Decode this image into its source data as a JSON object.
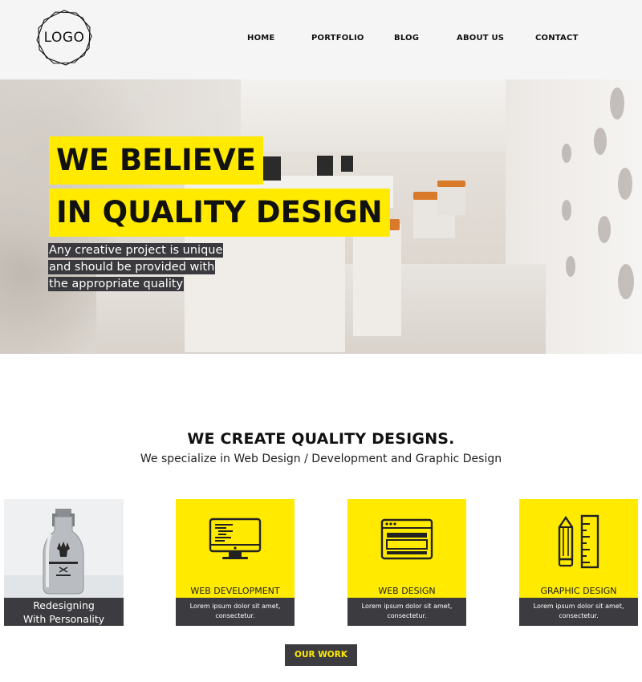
{
  "logo": {
    "text": "LOGO"
  },
  "nav": [
    {
      "label": "HOME"
    },
    {
      "label": "PORTFOLIO"
    },
    {
      "label": "BLOG"
    },
    {
      "label": "ABOUT US"
    },
    {
      "label": "CONTACT"
    }
  ],
  "hero": {
    "title_line1": "WE BELIEVE",
    "title_line2": "IN QUALITY DESIGN",
    "subtitle_lines": [
      "Any creative project is unique",
      "and should be provided with",
      "the appropriate quality"
    ]
  },
  "section": {
    "title": "WE CREATE QUALITY DESIGNS.",
    "subtitle": "We specialize in Web Design / Development and Graphic Design"
  },
  "photo_card": {
    "caption_line1": "Redesigning",
    "caption_line2": "With Personality"
  },
  "cards": [
    {
      "title": "WEB DEVELOPMENT",
      "text_line1": "Lorem ipsum dolor sit amet,",
      "text_line2": "consectetur.",
      "icon": "computer-monitor-icon"
    },
    {
      "title": "WEB DESIGN",
      "text_line1": "Lorem ipsum dolor sit amet,",
      "text_line2": "consectetur.",
      "icon": "browser-window-icon"
    },
    {
      "title": "GRAPHIC DESIGN",
      "text_line1": "Lorem ipsum dolor sit amet,",
      "text_line2": "consectetur.",
      "icon": "pencil-ruler-icon"
    }
  ],
  "cta": {
    "label": "OUR WORK"
  },
  "colors": {
    "accent": "#ffea00",
    "dark": "#3c3c40",
    "header_bg": "#f5f5f5"
  }
}
